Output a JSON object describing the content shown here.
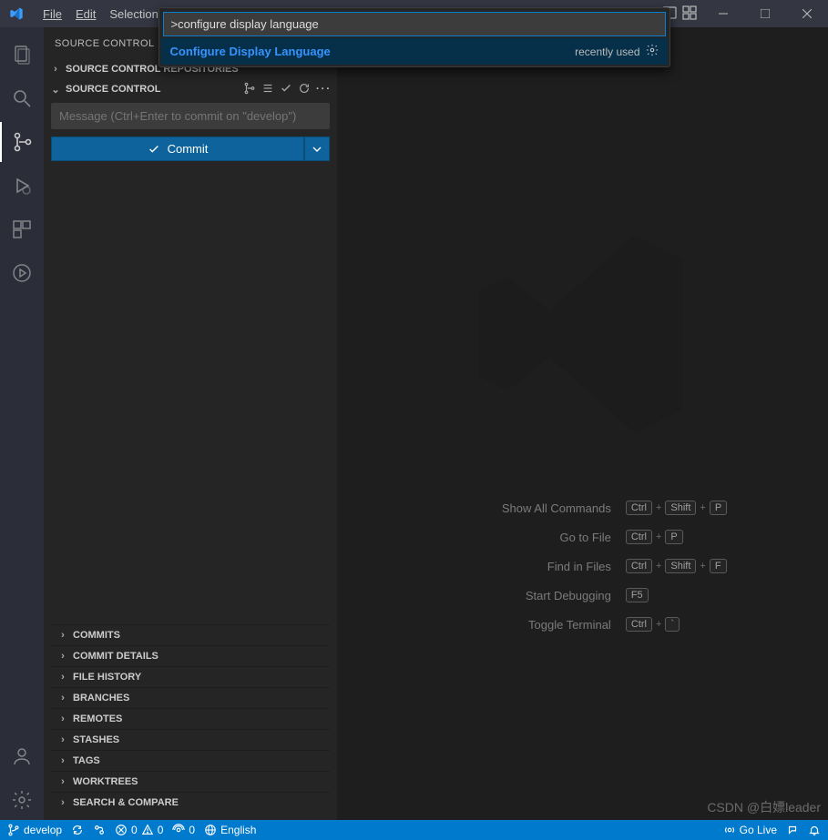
{
  "menubar": {
    "items": [
      "File",
      "Edit",
      "Selection"
    ]
  },
  "palette": {
    "input_value": ">configure display language",
    "results": [
      {
        "title": "Configure Display Language",
        "meta": "recently used"
      }
    ]
  },
  "sidebar": {
    "header_title": "SOURCE CONTROL",
    "sections": {
      "repos": {
        "title": "SOURCE CONTROL REPOSITORIES",
        "expanded": false
      },
      "scm": {
        "title": "SOURCE CONTROL",
        "expanded": true,
        "msg_placeholder": "Message (Ctrl+Enter to commit on \"develop\")",
        "commit_label": "Commit"
      },
      "gitlens": [
        "COMMITS",
        "COMMIT DETAILS",
        "FILE HISTORY",
        "BRANCHES",
        "REMOTES",
        "STASHES",
        "TAGS",
        "WORKTREES",
        "SEARCH & COMPARE"
      ]
    }
  },
  "welcome_help": [
    {
      "label": "Show All Commands",
      "keys": [
        "Ctrl",
        "Shift",
        "P"
      ]
    },
    {
      "label": "Go to File",
      "keys": [
        "Ctrl",
        "P"
      ]
    },
    {
      "label": "Find in Files",
      "keys": [
        "Ctrl",
        "Shift",
        "F"
      ]
    },
    {
      "label": "Start Debugging",
      "keys": [
        "F5"
      ]
    },
    {
      "label": "Toggle Terminal",
      "keys": [
        "Ctrl",
        "`"
      ]
    }
  ],
  "statusbar": {
    "branch": "develop",
    "errors": "0",
    "warnings": "0",
    "ports": "0",
    "language": "English",
    "golive": "Go Live"
  },
  "watermark": "CSDN @白嫖leader"
}
